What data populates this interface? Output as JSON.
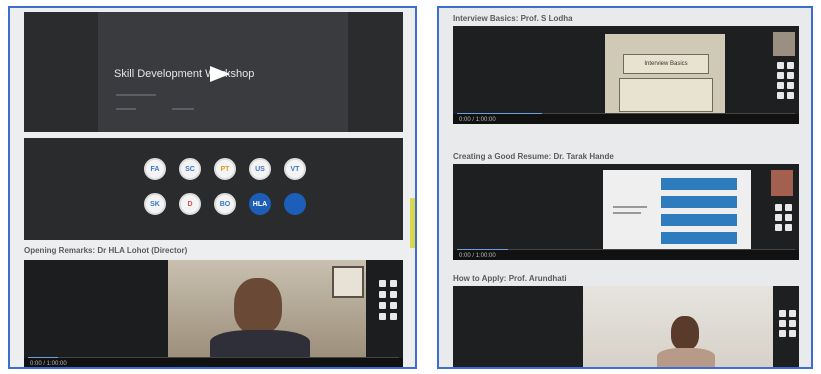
{
  "left_photo": {
    "slide": {
      "title": "Skill Development Workshop"
    },
    "participants": [
      {
        "initials": "FA",
        "color": "#3b78c8"
      },
      {
        "initials": "SC",
        "color": "#3b78c8"
      },
      {
        "initials": "PT",
        "color": "#d9a020"
      },
      {
        "initials": "US",
        "color": "#3b78c8"
      },
      {
        "initials": "VT",
        "color": "#3b78c8"
      },
      {
        "initials": "SK",
        "color": "#3b78c8"
      },
      {
        "initials": "D",
        "color": "#d9534f"
      },
      {
        "initials": "BO",
        "color": "#3b78c8"
      },
      {
        "initials": "HLA",
        "color": "#ffffff"
      },
      {
        "initials": "",
        "color": "#ffffff"
      }
    ],
    "caption": "Opening Remarks: Dr HLA Lohot (Director)",
    "video": {
      "control_text": "0:00 / 1:00:00",
      "progress": 0.08
    }
  },
  "right_photo": {
    "sections": [
      {
        "caption": "Interview Basics: Prof. S Lodha",
        "control_text": "0:00 / 1:00:00",
        "progress": 0.25
      },
      {
        "caption": "Creating a Good Resume: Dr. Tarak Hande",
        "control_text": "0:00 / 1:00:00",
        "progress": 0.15
      },
      {
        "caption": "How to Apply: Prof. Arundhati"
      }
    ],
    "slide_text": "Interview Basics"
  }
}
